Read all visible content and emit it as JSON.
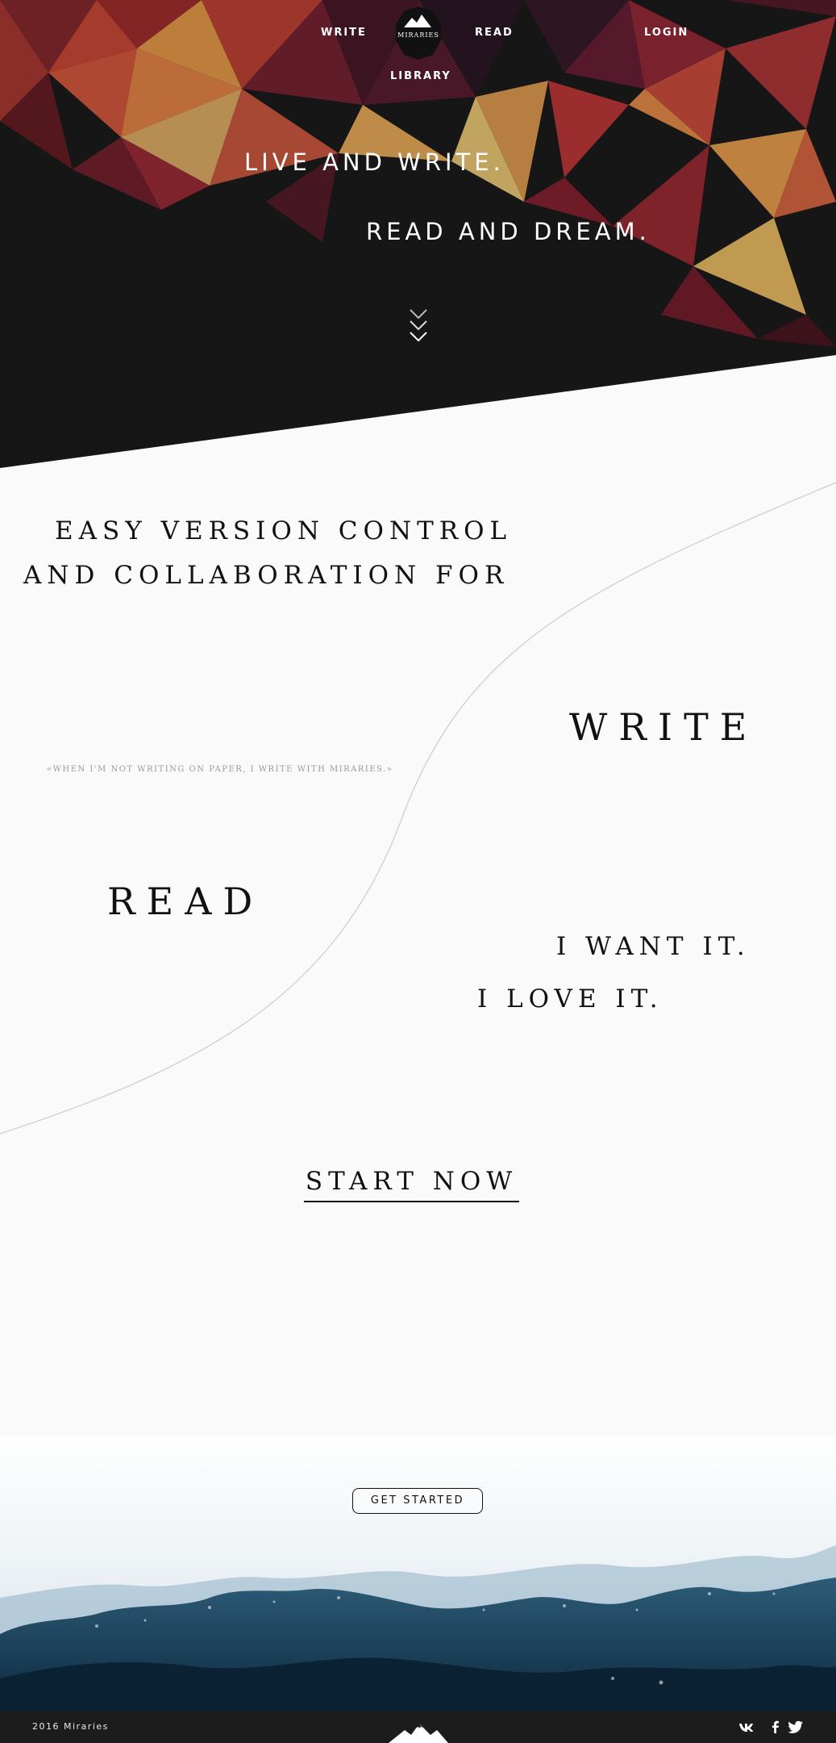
{
  "nav": {
    "write": "WRITE",
    "read": "READ",
    "library": "LIBRARY",
    "login": "LOGIN",
    "logo_text": "MIRARIES"
  },
  "hero": {
    "line1": "LIVE AND WRITE.",
    "line2": "READ AND DREAM.",
    "scroll_icon": "chevron-down-triple-icon"
  },
  "features": {
    "heading_line1": "EASY VERSION CONTROL",
    "heading_line2": "AND COLLABORATION FOR",
    "write_word": "WRITE",
    "read_word": "READ",
    "quote": "«WHEN I'M NOT WRITING ON PAPER, I WRITE WITH MIRARIES.»",
    "want_it": "I WANT IT.",
    "love_it": "I LOVE IT.",
    "cta": "START NOW"
  },
  "footer": {
    "get_started": "GET STARTED",
    "copyright": "2016 Miraries",
    "social": [
      "vk-icon",
      "facebook-icon",
      "twitter-icon"
    ]
  },
  "colors": {
    "hero_dark": "#1c1c1c",
    "page_bg": "#fafafa",
    "text_dark": "#111111",
    "quote_gray": "#9a9a9a"
  }
}
